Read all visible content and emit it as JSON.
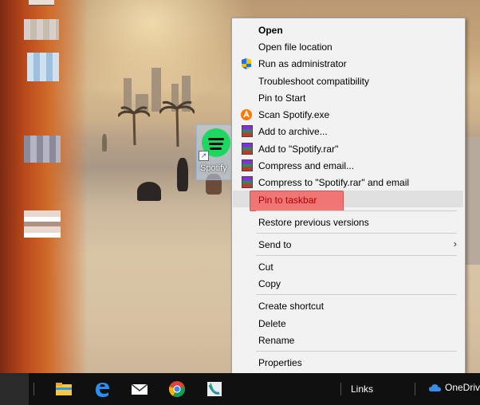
{
  "desktop": {
    "spotify_shortcut_label": "Spotify"
  },
  "context_menu": {
    "items": [
      {
        "label": "Open",
        "icon": "none",
        "bold": true
      },
      {
        "label": "Open file location",
        "icon": "none"
      },
      {
        "label": "Run as administrator",
        "icon": "uac-shield-icon"
      },
      {
        "label": "Troubleshoot compatibility",
        "icon": "none"
      },
      {
        "label": "Pin to Start",
        "icon": "none"
      },
      {
        "label": "Scan Spotify.exe",
        "icon": "avast-icon"
      },
      {
        "label": "Add to archive...",
        "icon": "winrar-icon"
      },
      {
        "label": "Add to \"Spotify.rar\"",
        "icon": "winrar-icon"
      },
      {
        "label": "Compress and email...",
        "icon": "winrar-icon"
      },
      {
        "label": "Compress to \"Spotify.rar\" and email",
        "icon": "winrar-icon"
      },
      {
        "label": "Pin to taskbar",
        "icon": "none",
        "highlighted": true
      },
      {
        "label": "Restore previous versions",
        "icon": "none"
      },
      {
        "label": "Send to",
        "icon": "none",
        "submenu": true
      },
      {
        "label": "Cut",
        "icon": "none"
      },
      {
        "label": "Copy",
        "icon": "none"
      },
      {
        "label": "Create shortcut",
        "icon": "none"
      },
      {
        "label": "Delete",
        "icon": "none"
      },
      {
        "label": "Rename",
        "icon": "none"
      },
      {
        "label": "Properties",
        "icon": "none"
      }
    ],
    "highlight_color": "#f26b6b",
    "submenu_arrow": "›"
  },
  "taskbar": {
    "pinned": [
      "file-explorer-icon",
      "edge-icon",
      "mail-icon",
      "chrome-icon",
      "app-icon"
    ],
    "links_label": "Links",
    "onedrive_label": "OneDrive"
  }
}
